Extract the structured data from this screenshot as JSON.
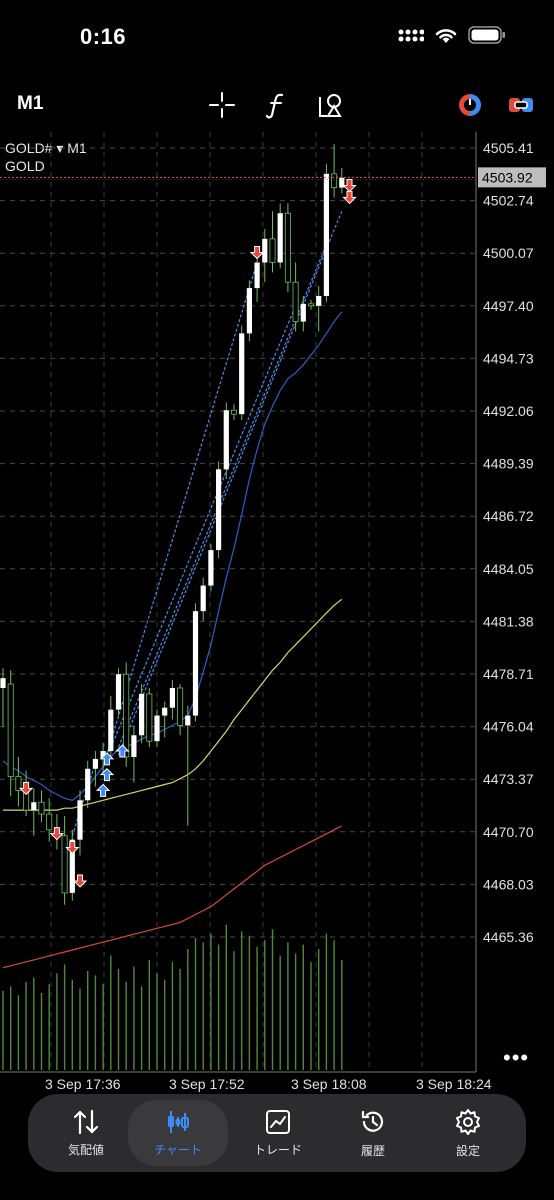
{
  "status": {
    "time": "0:16"
  },
  "toolbar": {
    "timeframe": "M1"
  },
  "symbol": {
    "line1": "GOLD# ▾ M1",
    "line2": "GOLD"
  },
  "price_axis": {
    "labels": [
      "4505.41",
      "4502.74",
      "4500.07",
      "4497.40",
      "4494.73",
      "4492.06",
      "4489.39",
      "4486.72",
      "4484.05",
      "4481.38",
      "4478.71",
      "4476.04",
      "4473.37",
      "4470.70",
      "4468.03",
      "4465.36"
    ],
    "current": "4503.92"
  },
  "time_axis": {
    "labels": [
      "3 Sep 17:36",
      "3 Sep 17:52",
      "3 Sep 18:08",
      "3 Sep 18:24"
    ]
  },
  "nav": {
    "items": [
      {
        "label": "気配値",
        "icon": "quotes-icon"
      },
      {
        "label": "チャート",
        "icon": "chart-icon",
        "active": true
      },
      {
        "label": "トレード",
        "icon": "trade-icon"
      },
      {
        "label": "履歴",
        "icon": "history-icon"
      },
      {
        "label": "設定",
        "icon": "settings-icon"
      }
    ]
  },
  "colors": {
    "background": "#000000",
    "accent": "#3b8df5",
    "bull": "#ffffff",
    "bear": "#000000",
    "wick": "#6fbf5a",
    "bid_line": "#e05a4a",
    "sell_arrow": "#e8463a",
    "buy_arrow": "#3b8df5"
  },
  "chart_data": {
    "type": "candlestick",
    "y_range": [
      4464.0,
      4507.5
    ],
    "candles": [
      [
        4478.0,
        4479.0,
        4476.0,
        4478.5
      ],
      [
        4478.2,
        4478.9,
        4472.5,
        4473.5
      ],
      [
        4473.5,
        4474.5,
        4472.0,
        4472.8
      ],
      [
        4472.8,
        4473.8,
        4471.5,
        4471.8
      ],
      [
        4471.8,
        4472.9,
        4470.5,
        4472.2
      ],
      [
        4472.2,
        4472.8,
        4471.2,
        4471.6
      ],
      [
        4471.6,
        4472.4,
        4470.2,
        4470.8
      ],
      [
        4470.8,
        4471.6,
        4469.8,
        4470.5
      ],
      [
        4470.5,
        4471.5,
        4467.0,
        4467.6
      ],
      [
        4467.6,
        4470.8,
        4467.2,
        4470.3
      ],
      [
        4470.3,
        4472.8,
        4469.5,
        4472.3
      ],
      [
        4472.3,
        4474.3,
        4471.9,
        4473.9
      ],
      [
        4473.9,
        4474.8,
        4473.0,
        4474.4
      ],
      [
        4474.4,
        4475.2,
        4473.6,
        4474.8
      ],
      [
        4474.8,
        4477.6,
        4474.5,
        4476.9
      ],
      [
        4476.9,
        4479.0,
        4476.6,
        4478.7
      ],
      [
        4478.7,
        4479.3,
        4474.0,
        4474.5
      ],
      [
        4474.5,
        4476.1,
        4473.2,
        4475.6
      ],
      [
        4475.6,
        4478.2,
        4475.2,
        4477.7
      ],
      [
        4477.7,
        4478.0,
        4475.0,
        4475.3
      ],
      [
        4475.3,
        4476.9,
        4475.0,
        4476.6
      ],
      [
        4476.6,
        4477.3,
        4475.5,
        4477.0
      ],
      [
        4477.0,
        4478.4,
        4476.4,
        4478.0
      ],
      [
        4478.0,
        4478.2,
        4475.6,
        4476.1
      ],
      [
        4476.1,
        4477.1,
        4471.0,
        4476.6
      ],
      [
        4476.6,
        4482.3,
        4476.3,
        4481.9
      ],
      [
        4481.9,
        4483.6,
        4481.4,
        4483.2
      ],
      [
        4483.2,
        4485.3,
        4482.9,
        4485.0
      ],
      [
        4485.0,
        4489.5,
        4484.6,
        4489.1
      ],
      [
        4489.1,
        4492.5,
        4488.6,
        4492.1
      ],
      [
        4492.1,
        4492.4,
        4491.6,
        4491.9
      ],
      [
        4491.9,
        4496.4,
        4491.6,
        4496.0
      ],
      [
        4496.0,
        4498.7,
        4495.6,
        4498.3
      ],
      [
        4498.3,
        4499.9,
        4497.6,
        4499.6
      ],
      [
        4499.6,
        4501.3,
        4498.6,
        4500.8
      ],
      [
        4500.8,
        4502.2,
        4499.1,
        4499.6
      ],
      [
        4499.6,
        4502.6,
        4499.3,
        4502.1
      ],
      [
        4502.1,
        4502.6,
        4498.1,
        4498.6
      ],
      [
        4498.6,
        4499.6,
        4496.1,
        4496.6
      ],
      [
        4496.6,
        4497.9,
        4496.1,
        4497.5
      ],
      [
        4497.5,
        4497.7,
        4497.2,
        4497.4
      ],
      [
        4497.4,
        4498.4,
        4496.1,
        4497.9
      ],
      [
        4497.9,
        4504.6,
        4497.6,
        4504.1
      ],
      [
        4504.1,
        4505.6,
        4502.9,
        4503.4
      ],
      [
        4503.4,
        4504.4,
        4503.1,
        4503.9
      ]
    ],
    "ma_series": [
      {
        "color": "#2f5ec9",
        "values": [
          4474.3,
          4474.0,
          4473.8,
          4473.5,
          4473.3,
          4473.1,
          4472.8,
          4472.6,
          4472.4,
          4472.3,
          4472.6,
          4473.0,
          4473.5,
          4474.0,
          4474.5,
          4474.9,
          4475.0,
          4475.2,
          4475.4,
          4475.6,
          4475.7,
          4475.9,
          4476.1,
          4476.3,
          4476.6,
          4477.5,
          4478.8,
          4480.2,
          4481.9,
          4483.6,
          4485.1,
          4486.8,
          4488.6,
          4490.1,
          4491.4,
          4492.3,
          4493.1,
          4493.7,
          4494.0,
          4494.4,
          4494.9,
          4495.4,
          4496.0,
          4496.6,
          4497.1
        ]
      },
      {
        "color": "#d8d86a",
        "values": [
          4471.8,
          4471.8,
          4471.8,
          4471.8,
          4471.8,
          4471.8,
          4471.8,
          4471.8,
          4471.9,
          4471.9,
          4472.0,
          4472.1,
          4472.2,
          4472.3,
          4472.4,
          4472.5,
          4472.6,
          4472.7,
          4472.8,
          4472.9,
          4473.0,
          4473.1,
          4473.2,
          4473.4,
          4473.6,
          4473.9,
          4474.3,
          4474.8,
          4475.3,
          4475.8,
          4476.4,
          4476.9,
          4477.4,
          4477.9,
          4478.4,
          4478.9,
          4479.3,
          4479.8,
          4480.2,
          4480.6,
          4481.0,
          4481.4,
          4481.8,
          4482.2,
          4482.5
        ]
      },
      {
        "color": "#d84a3a",
        "values": [
          4463.8,
          4463.9,
          4464.0,
          4464.1,
          4464.2,
          4464.3,
          4464.4,
          4464.5,
          4464.6,
          4464.7,
          4464.8,
          4464.9,
          4465.0,
          4465.1,
          4465.2,
          4465.3,
          4465.4,
          4465.5,
          4465.6,
          4465.7,
          4465.8,
          4465.9,
          4466.0,
          4466.1,
          4466.3,
          4466.5,
          4466.7,
          4466.9,
          4467.2,
          4467.5,
          4467.8,
          4468.1,
          4468.4,
          4468.7,
          4469.0,
          4469.2,
          4469.4,
          4469.6,
          4469.8,
          4470.0,
          4470.2,
          4470.4,
          4470.6,
          4470.8,
          4471.0
        ]
      }
    ],
    "volume": [
      36,
      38,
      34,
      40,
      42,
      35,
      39,
      44,
      48,
      41,
      37,
      45,
      43,
      39,
      52,
      46,
      40,
      47,
      38,
      50,
      44,
      41,
      49,
      46,
      55,
      60,
      58,
      62,
      57,
      66,
      54,
      63,
      61,
      56,
      59,
      64,
      52,
      58,
      53,
      57,
      49,
      55,
      62,
      59,
      50
    ],
    "price_line": 4503.92
  }
}
